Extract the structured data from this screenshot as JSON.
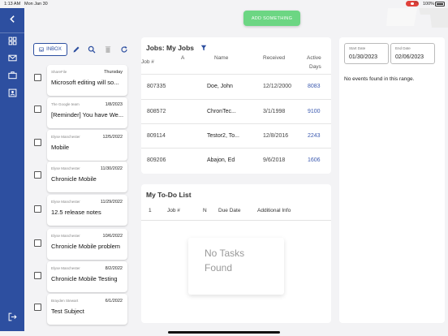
{
  "status_bar": {
    "time": "1:13 AM",
    "date": "Mon Jan 30",
    "battery": "100%"
  },
  "header": {
    "add_button": "ADD SOMETHING"
  },
  "inbox": {
    "button_label": "INBOX",
    "messages": [
      {
        "sender": "ShareFile",
        "date": "Thursday",
        "subject": "Microsoft editing will so..."
      },
      {
        "sender": "The Google team",
        "date": "1/8/2023",
        "subject": "[Reminder] You have We..."
      },
      {
        "sender": "Elyse Manchester",
        "date": "12/5/2022",
        "subject": "Mobile"
      },
      {
        "sender": "Elyse Manchester",
        "date": "11/30/2022",
        "subject": "Chronicle Mobile"
      },
      {
        "sender": "Elyse Manchester",
        "date": "11/29/2022",
        "subject": "12.5 release notes"
      },
      {
        "sender": "Elyse Manchester",
        "date": "10/6/2022",
        "subject": "Chronicle Mobile problem"
      },
      {
        "sender": "Elyse Manchester",
        "date": "8/2/2022",
        "subject": "Chronicle Mobile Testing"
      },
      {
        "sender": "Brayden Stewart",
        "date": "6/1/2022",
        "subject": "Test Subject"
      }
    ]
  },
  "jobs": {
    "title": "Jobs: My Jobs",
    "columns": {
      "job": "Job #",
      "a": "A",
      "name": "Name",
      "received": "Received",
      "active1": "Active",
      "active2": "Days"
    },
    "rows": [
      {
        "job": "807335",
        "name": "Doe, John",
        "received": "12/12/2000",
        "days": "8083"
      },
      {
        "job": "808572",
        "name": "ChronTec...",
        "received": "3/1/1998",
        "days": "9100"
      },
      {
        "job": "809114",
        "name": "Testor2, To...",
        "received": "12/8/2016",
        "days": "2243"
      },
      {
        "job": "809206",
        "name": "Abajon, Ed",
        "received": "9/6/2018",
        "days": "1606"
      }
    ]
  },
  "todo": {
    "title": "My To-Do List",
    "columns": {
      "c1": "1",
      "c2": "Job #",
      "c3": "N",
      "c4": "Due Date",
      "c5": "Additional Info"
    },
    "empty_line1": "No Tasks",
    "empty_line2": "Found"
  },
  "events": {
    "start_label": "Start Date",
    "start_value": "01/30/2023",
    "end_label": "End Date",
    "end_value": "02/06/2023",
    "empty": "No events found in this range."
  },
  "colors": {
    "primary": "#2d4fa0",
    "accent_green": "#6cd683"
  }
}
